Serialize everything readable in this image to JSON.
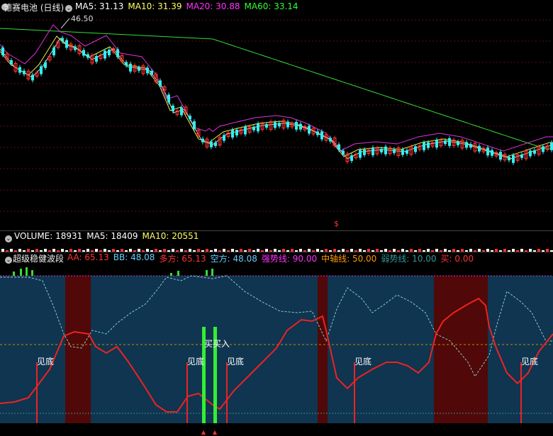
{
  "main": {
    "title": "德赛电池 (日线)",
    "ma_labels": [
      {
        "text": "MA5: 31.13",
        "color": "#ffffff"
      },
      {
        "text": "MA10: 31.39",
        "color": "#ffff66"
      },
      {
        "text": "MA20: 30.88",
        "color": "#ff33ff"
      },
      {
        "text": "MA60: 33.14",
        "color": "#33ff33"
      }
    ],
    "high_marker": "46.50",
    "low_marker": "$"
  },
  "volume": {
    "labels": [
      {
        "text": "VOLUME: 18931",
        "color": "#ffffff"
      },
      {
        "text": "MA5: 18409",
        "color": "#ffffff"
      },
      {
        "text": "MA10: 20551",
        "color": "#ffff66"
      }
    ]
  },
  "indicator": {
    "title": "超级稳健波段",
    "labels": [
      {
        "text": "AA: 65.13",
        "color": "#ff3333"
      },
      {
        "text": "BB: 48.08",
        "color": "#66ccff"
      },
      {
        "text": "多方: 65.13",
        "color": "#ff3333"
      },
      {
        "text": "空方: 48.08",
        "color": "#66ccff"
      },
      {
        "text": "强势线: 90.00",
        "color": "#ff33ff"
      },
      {
        "text": "中轴线: 50.00",
        "color": "#ff9900"
      },
      {
        "text": "弱势线: 10.00",
        "color": "#339999"
      },
      {
        "text": "买: 0.00",
        "color": "#ff3333"
      }
    ],
    "signals": [
      "见底",
      "见底",
      "见底",
      "见底",
      "见底"
    ],
    "buy_labels": [
      "买",
      "买入"
    ]
  }
}
